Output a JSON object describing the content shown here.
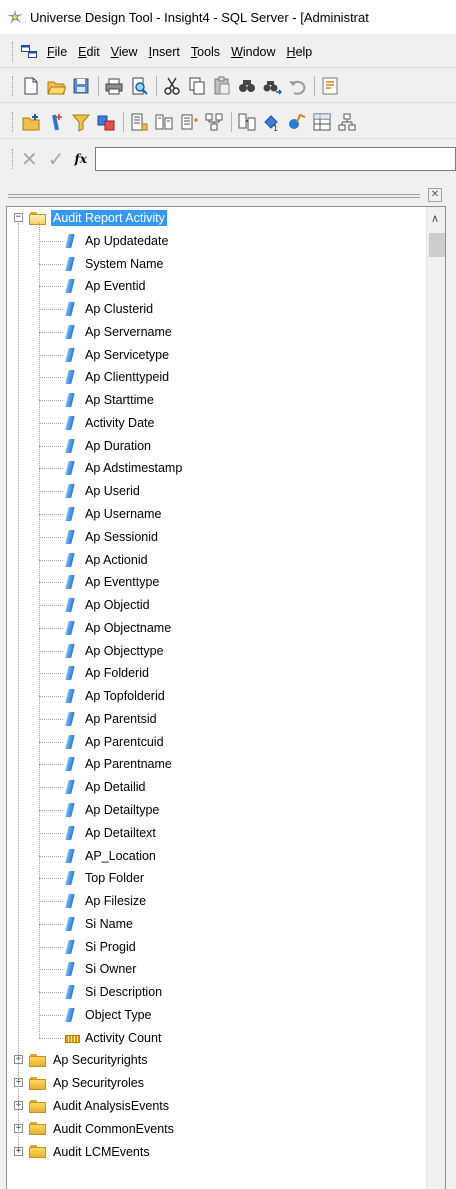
{
  "window": {
    "title": "Universe Design Tool - Insight4 - SQL Server - [Administrat"
  },
  "menu": [
    {
      "label": "File",
      "mnemonic": "F",
      "rest": "ile"
    },
    {
      "label": "Edit",
      "mnemonic": "E",
      "rest": "dit"
    },
    {
      "label": "View",
      "mnemonic": "V",
      "rest": "iew"
    },
    {
      "label": "Insert",
      "mnemonic": "I",
      "rest": "nsert"
    },
    {
      "label": "Tools",
      "mnemonic": "T",
      "rest": "ools"
    },
    {
      "label": "Window",
      "mnemonic": "W",
      "rest": "indow"
    },
    {
      "label": "Help",
      "mnemonic": "H",
      "rest": "elp"
    }
  ],
  "toolbar1": [
    "new-document-icon",
    "open-folder-icon",
    "save-icon",
    "|",
    "print-icon",
    "print-preview-icon",
    "|",
    "cut-icon",
    "copy-icon",
    "paste-icon",
    "find-icon",
    "find-next-icon",
    "undo-icon",
    "|",
    "properties-icon"
  ],
  "toolbar2": [
    "insert-class-icon",
    "insert-object-icon",
    "insert-condition-icon",
    "insert-join-icon",
    "|",
    "table-browser-icon",
    "insert-alias-icon",
    "insert-derived-table-icon",
    "arrange-tables-icon",
    "|",
    "detect-cardinalities-icon",
    "detect-contexts-icon",
    "check-integrity-icon",
    "list-mode-icon",
    "hierarchies-icon"
  ],
  "formula_bar": {
    "cancel_glyph": "✕",
    "accept_glyph": "✓",
    "fx_label": "fx",
    "value": ""
  },
  "tree": {
    "root": {
      "label": "Audit Report Activity",
      "expanded": true,
      "selected": true
    },
    "children": [
      {
        "label": "Ap Updatedate",
        "type": "dimension"
      },
      {
        "label": "System Name",
        "type": "dimension"
      },
      {
        "label": "Ap Eventid",
        "type": "dimension"
      },
      {
        "label": "Ap Clusterid",
        "type": "dimension"
      },
      {
        "label": "Ap Servername",
        "type": "dimension"
      },
      {
        "label": "Ap Servicetype",
        "type": "dimension"
      },
      {
        "label": "Ap Clienttypeid",
        "type": "dimension"
      },
      {
        "label": "Ap Starttime",
        "type": "dimension"
      },
      {
        "label": "Activity Date",
        "type": "dimension"
      },
      {
        "label": "Ap Duration",
        "type": "dimension"
      },
      {
        "label": "Ap Adstimestamp",
        "type": "dimension"
      },
      {
        "label": "Ap Userid",
        "type": "dimension"
      },
      {
        "label": "Ap Username",
        "type": "dimension"
      },
      {
        "label": "Ap Sessionid",
        "type": "dimension"
      },
      {
        "label": "Ap Actionid",
        "type": "dimension"
      },
      {
        "label": "Ap Eventtype",
        "type": "dimension"
      },
      {
        "label": "Ap Objectid",
        "type": "dimension"
      },
      {
        "label": "Ap Objectname",
        "type": "dimension"
      },
      {
        "label": "Ap Objecttype",
        "type": "dimension"
      },
      {
        "label": "Ap Folderid",
        "type": "dimension"
      },
      {
        "label": "Ap Topfolderid",
        "type": "dimension"
      },
      {
        "label": "Ap Parentsid",
        "type": "dimension"
      },
      {
        "label": "Ap Parentcuid",
        "type": "dimension"
      },
      {
        "label": "Ap Parentname",
        "type": "dimension"
      },
      {
        "label": "Ap Detailid",
        "type": "dimension"
      },
      {
        "label": "Ap Detailtype",
        "type": "dimension"
      },
      {
        "label": "Ap Detailtext",
        "type": "dimension"
      },
      {
        "label": "AP_Location",
        "type": "dimension"
      },
      {
        "label": "Top Folder",
        "type": "dimension"
      },
      {
        "label": "Ap Filesize",
        "type": "dimension"
      },
      {
        "label": "Si Name",
        "type": "dimension"
      },
      {
        "label": "Si Progid",
        "type": "dimension"
      },
      {
        "label": "Si Owner",
        "type": "dimension"
      },
      {
        "label": "Si Description",
        "type": "dimension"
      },
      {
        "label": "Object Type",
        "type": "dimension"
      },
      {
        "label": "Activity Count",
        "type": "measure"
      }
    ],
    "siblings": [
      {
        "label": "Ap Securityrights",
        "expanded": false
      },
      {
        "label": "Ap Securityroles",
        "expanded": false
      },
      {
        "label": "Audit AnalysisEvents",
        "expanded": false
      },
      {
        "label": "Audit CommonEvents",
        "expanded": false
      },
      {
        "label": "Audit LCMEvents",
        "expanded": false
      }
    ]
  }
}
